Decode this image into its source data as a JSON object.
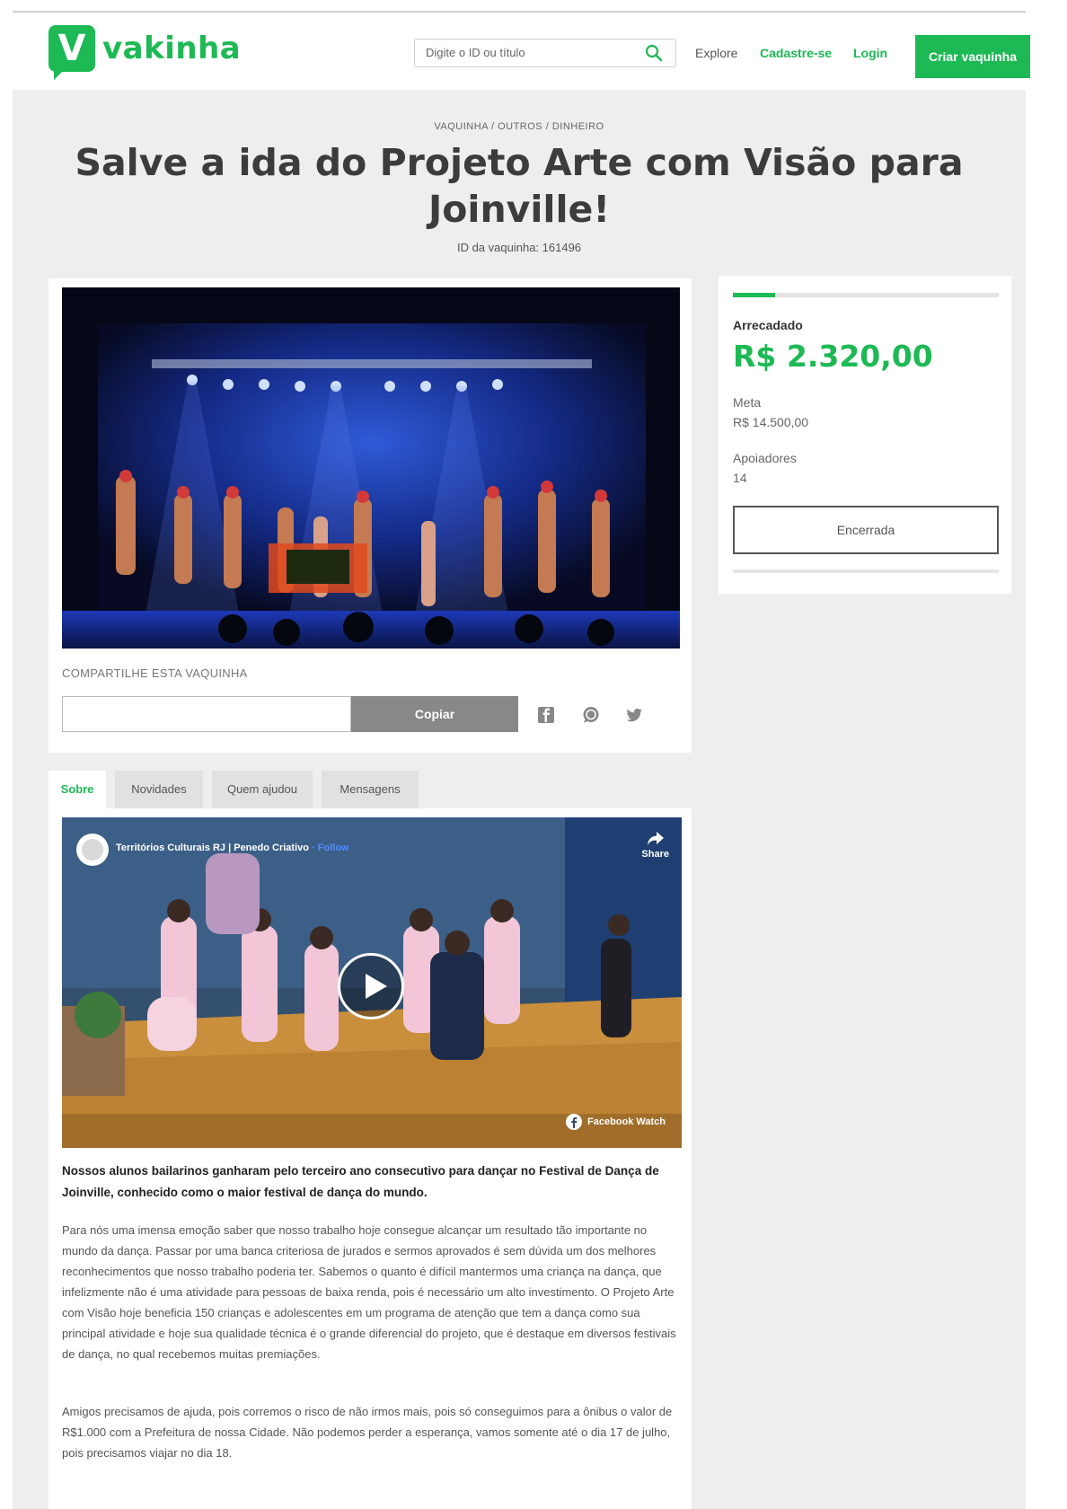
{
  "brand": {
    "name": "vakinha",
    "letter": "V",
    "color": "#1db954"
  },
  "header": {
    "search_placeholder": "Digite o ID ou título",
    "nav": {
      "explore": "Explore",
      "register": "Cadastre-se",
      "login": "Login"
    },
    "cta": "Criar vaquinha"
  },
  "campaign": {
    "category": "VAQUINHA / OUTROS / DINHEIRO",
    "title": "Salve a ida do Projeto Arte com Visão para Joinville!",
    "vaquinha_id": "ID da vaquinha: 161496"
  },
  "share": {
    "label": "COMPARTILHE ESTA VAQUINHA",
    "link_value": "",
    "copy_button": "Copiar",
    "networks": [
      "facebook-icon",
      "whatsapp-icon",
      "twitter-icon"
    ]
  },
  "stats": {
    "raised_label": "Arrecadado",
    "raised_value": "R$ 2.320,00",
    "goal_label": "Meta",
    "goal_value": "R$ 14.500,00",
    "supporters_label": "Apoiadores",
    "supporters_value": "14",
    "status_button": "Encerrada",
    "progress_fraction": 0.16
  },
  "tabs": [
    {
      "label": "Sobre",
      "active": true
    },
    {
      "label": "Novidades",
      "active": false
    },
    {
      "label": "Quem ajudou",
      "active": false
    },
    {
      "label": "Mensagens",
      "active": false
    }
  ],
  "video": {
    "channel": "Territórios Culturais RJ | Penedo Criativo",
    "follow": "· Follow",
    "share": "Share",
    "badge": "Facebook Watch"
  },
  "story": {
    "lead": "Nossos alunos bailarinos ganharam pelo terceiro ano consecutivo para dançar no Festival de Dança de Joinville, conhecido como o maior festival de dança do mundo.",
    "paragraphs": [
      "Para nós uma imensa emoção saber que nosso trabalho hoje consegue alcançar um resultado tão importante no mundo da dança. Passar por uma banca criteriosa de jurados e sermos aprovados é sem dúvida um dos melhores reconhecimentos que nosso trabalho poderia ter. Sabemos o quanto é difícil mantermos uma criança na dança, que infelizmente não é uma atividade para pessoas de baixa renda, pois é necessário um alto investimento. O Projeto Arte com Visão hoje beneficia 150 crianças e adolescentes em um programa de atenção que tem a dança como sua principal atividade e hoje sua qualidade técnica é o grande diferencial do projeto, que é destaque em diversos festivais de dança, no qual recebemos muitas premiações.",
      "Amigos precisamos de ajuda, pois corremos o risco de não irmos mais, pois só conseguimos para a ônibus o valor de R$1.000 com a Prefeitura de nossa Cidade. Não podemos perder a esperança, vamos somente até o dia 17 de julho, pois precisamos viajar no dia 18."
    ]
  }
}
